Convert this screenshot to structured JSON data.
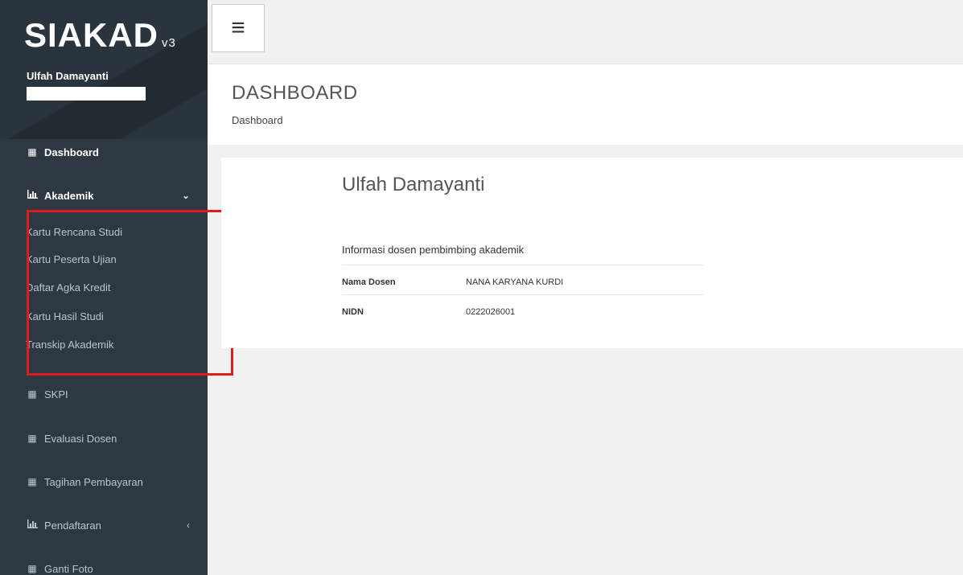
{
  "brand": {
    "logo": "SIAKAD",
    "version": "v3"
  },
  "user": {
    "name": "Ulfah Damayanti"
  },
  "sidebar": {
    "items": [
      {
        "label": "Dashboard",
        "icon": "grid-icon"
      },
      {
        "label": "Akademik",
        "icon": "bar-chart-icon",
        "chevron": "⌄"
      },
      {
        "label": "SKPI",
        "icon": "grid-icon"
      },
      {
        "label": "Evaluasi Dosen",
        "icon": "grid-icon"
      },
      {
        "label": "Tagihan Pembayaran",
        "icon": "grid-icon"
      },
      {
        "label": "Pendaftaran",
        "icon": "bar-chart-icon",
        "chevron": "‹"
      },
      {
        "label": "Ganti Foto",
        "icon": "grid-icon"
      }
    ],
    "submenu": [
      "Kartu Rencana Studi",
      "Kartu Peserta Ujian",
      "Daftar Agka Kredit",
      "Kartu Hasil Studi",
      "Transkip Akademik"
    ]
  },
  "header": {
    "title": "DASHBOARD",
    "breadcrumb": "Dashboard"
  },
  "card": {
    "name": "Ulfah Damayanti",
    "info_title": "Informasi dosen pembimbing akademik",
    "rows": [
      {
        "label": "Nama Dosen",
        "value": "NANA KARYANA KURDI"
      },
      {
        "label": "NIDN",
        "value": "0222026001"
      }
    ]
  },
  "colors": {
    "sidebar": "#2d3841",
    "highlight": "#e01b1b"
  }
}
